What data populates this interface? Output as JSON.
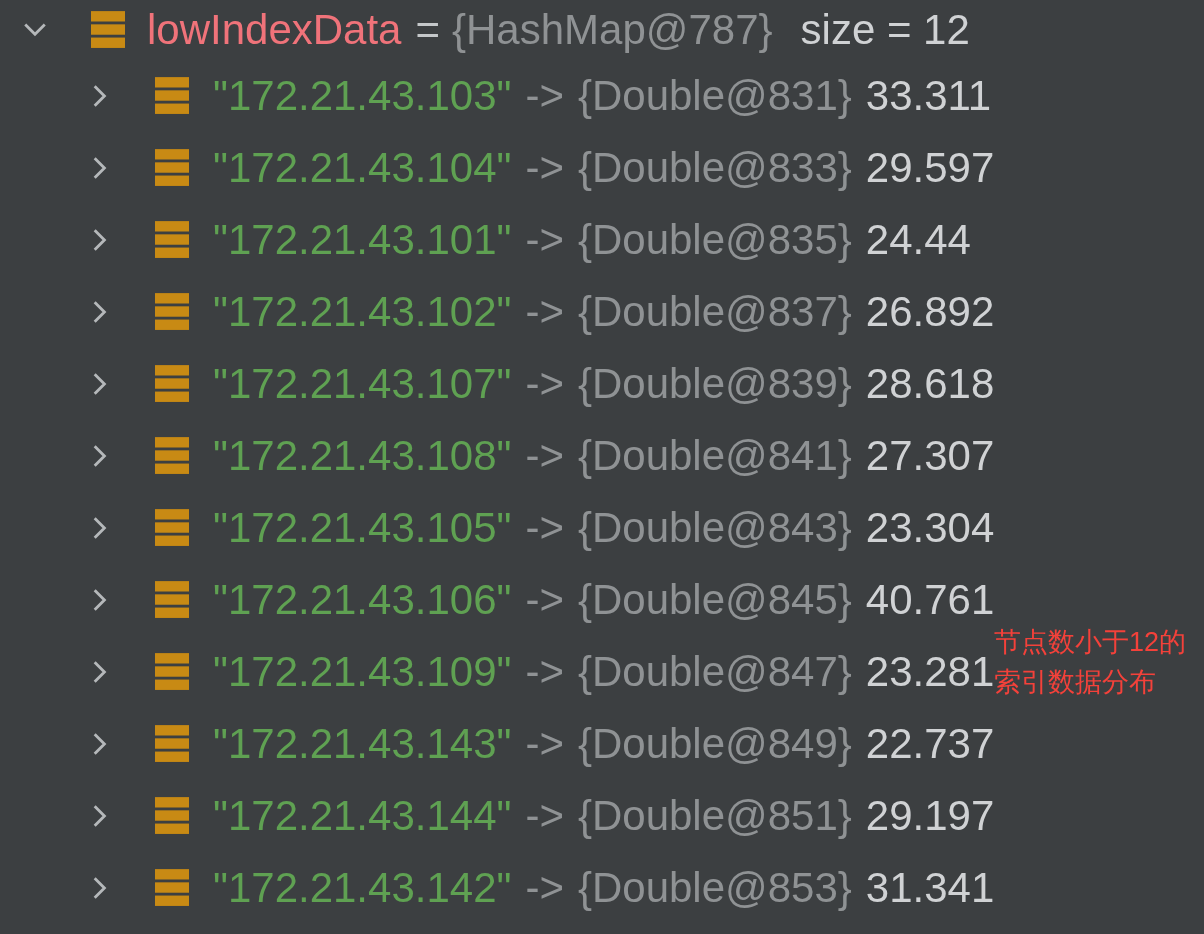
{
  "variable": {
    "name": "lowIndexData",
    "expanded": true,
    "operator": "=",
    "ref": "{HashMap@787}",
    "size": "size = 12",
    "children": [
      {
        "key": "\"172.21.43.103\"",
        "arrow": "->",
        "ref": "{Double@831}",
        "value": "33.311",
        "expanded": false
      },
      {
        "key": "\"172.21.43.104\"",
        "arrow": "->",
        "ref": "{Double@833}",
        "value": "29.597",
        "expanded": false
      },
      {
        "key": "\"172.21.43.101\"",
        "arrow": "->",
        "ref": "{Double@835}",
        "value": "24.44",
        "expanded": false
      },
      {
        "key": "\"172.21.43.102\"",
        "arrow": "->",
        "ref": "{Double@837}",
        "value": "26.892",
        "expanded": false
      },
      {
        "key": "\"172.21.43.107\"",
        "arrow": "->",
        "ref": "{Double@839}",
        "value": "28.618",
        "expanded": false
      },
      {
        "key": "\"172.21.43.108\"",
        "arrow": "->",
        "ref": "{Double@841}",
        "value": "27.307",
        "expanded": false
      },
      {
        "key": "\"172.21.43.105\"",
        "arrow": "->",
        "ref": "{Double@843}",
        "value": "23.304",
        "expanded": false
      },
      {
        "key": "\"172.21.43.106\"",
        "arrow": "->",
        "ref": "{Double@845}",
        "value": "40.761",
        "expanded": false
      },
      {
        "key": "\"172.21.43.109\"",
        "arrow": "->",
        "ref": "{Double@847}",
        "value": "23.281",
        "expanded": false
      },
      {
        "key": "\"172.21.43.143\"",
        "arrow": "->",
        "ref": "{Double@849}",
        "value": "22.737",
        "expanded": false
      },
      {
        "key": "\"172.21.43.144\"",
        "arrow": "->",
        "ref": "{Double@851}",
        "value": "29.197",
        "expanded": false
      },
      {
        "key": "\"172.21.43.142\"",
        "arrow": "->",
        "ref": "{Double@853}",
        "value": "31.341",
        "expanded": false
      }
    ]
  },
  "annotation": {
    "lines": [
      "节点数小于12的",
      "索引数据分布"
    ]
  }
}
